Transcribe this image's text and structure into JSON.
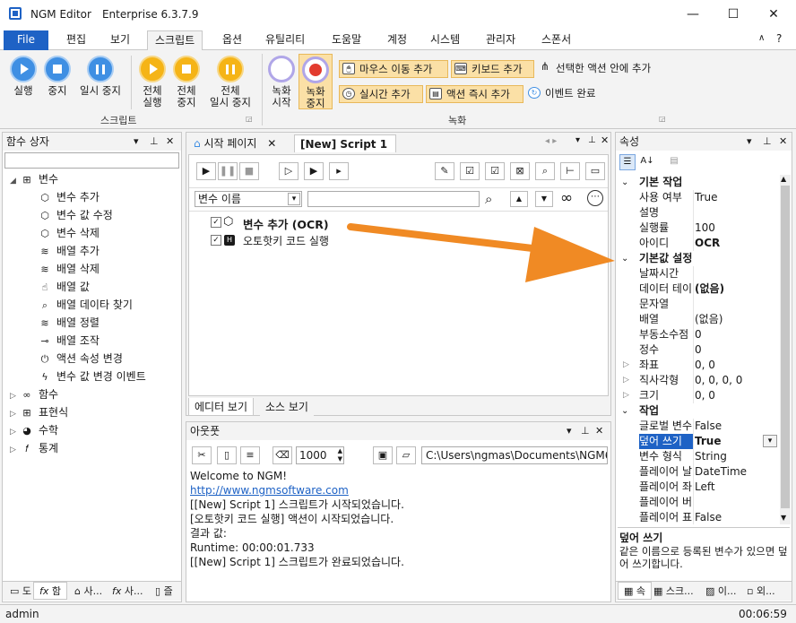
{
  "window": {
    "app_name": "NGM Editor",
    "edition": "Enterprise 6.3.7.9",
    "controls": {
      "minimize": "—",
      "maximize": "☐",
      "close": "✕"
    }
  },
  "menu": {
    "file": "File",
    "tabs": [
      "편집",
      "보기",
      "스크립트",
      "옵션",
      "유틸리티",
      "도움말",
      "계정",
      "시스템",
      "관리자",
      "스폰서"
    ],
    "active_tab": "스크립트"
  },
  "ribbon": {
    "script_group": {
      "label": "스크립트",
      "buttons": {
        "run": "실행",
        "stop": "중지",
        "pause": "일시 중지",
        "run_all": [
          "전체",
          "실행"
        ],
        "stop_all": [
          "전체",
          "중지"
        ],
        "pause_all": [
          "전체",
          "일시 중지"
        ]
      }
    },
    "record_group": {
      "label": "녹화",
      "record_start": [
        "녹화",
        "시작"
      ],
      "record_stop": [
        "녹화",
        "중지"
      ],
      "mouse_move_add": "마우스 이동 추가",
      "keyboard_add": "키보드 추가",
      "add_in_selected_action": "선택한 액션 안에 추가",
      "realtime_add": "실시간 추가",
      "instant_action_add": "액션 즉시 추가",
      "event_complete": "이벤트 완료"
    }
  },
  "left_panel": {
    "title": "함수 상자",
    "tree": [
      {
        "label": "변수",
        "icon": "hierarchy-icon",
        "expanded": true,
        "level": 0
      },
      {
        "label": "변수 추가",
        "icon": "cube-icon",
        "level": 1
      },
      {
        "label": "변수 값 수정",
        "icon": "cube-icon",
        "level": 1
      },
      {
        "label": "변수 삭제",
        "icon": "cube-icon",
        "level": 1
      },
      {
        "label": "배열 추가",
        "icon": "database-icon",
        "level": 1
      },
      {
        "label": "배열 삭제",
        "icon": "database-icon",
        "level": 1
      },
      {
        "label": "배열 값",
        "icon": "pointer-icon",
        "level": 1
      },
      {
        "label": "배열 데이타 찾기",
        "icon": "magnifier-icon",
        "level": 1
      },
      {
        "label": "배열 정렬",
        "icon": "database-icon",
        "level": 1
      },
      {
        "label": "배열 조작",
        "icon": "toggle-icon",
        "level": 1
      },
      {
        "label": "액션 속성 변경",
        "icon": "power-icon",
        "level": 1
      },
      {
        "label": "변수 값 변경 이벤트",
        "icon": "lightning-icon",
        "level": 1
      },
      {
        "label": "함수",
        "icon": "infinity-icon",
        "expanded": false,
        "level": 0
      },
      {
        "label": "표현식",
        "icon": "grid-icon",
        "expanded": false,
        "level": 0
      },
      {
        "label": "수학",
        "icon": "pie-icon",
        "expanded": false,
        "level": 0
      },
      {
        "label": "통계",
        "icon": "fx-icon",
        "expanded": false,
        "level": 0
      }
    ],
    "bottom_tabs": [
      "도",
      "함",
      "사...",
      "사...",
      "즐"
    ]
  },
  "editor": {
    "tabs": [
      {
        "label": "시작 페이지",
        "active": false
      },
      {
        "label": "[New] Script 1",
        "active": true
      }
    ],
    "variable_dropdown": "변수 이름",
    "search_value": "",
    "actions": [
      {
        "label": "변수 추가 (OCR)",
        "checked": true,
        "bold": true,
        "icon": "cube-icon"
      },
      {
        "label": "오토핫키 코드 실행",
        "checked": true,
        "bold": false,
        "icon": "autohotkey-icon"
      }
    ],
    "bottom_tabs": [
      "에디터 보기",
      "소스 보기"
    ]
  },
  "output": {
    "title": "아웃풋",
    "font_size": "1000",
    "path": "C:\\Users\\ngmas\\Documents\\NGM6\\",
    "lines": [
      {
        "text": "Welcome to NGM!",
        "link": false
      },
      {
        "text": "http://www.ngmsoftware.com",
        "link": true
      },
      {
        "text": "[[New] Script 1] 스크립트가 시작되었습니다.",
        "link": false
      },
      {
        "text": "[오토핫키 코드 실행] 액션이 시작되었습니다.",
        "link": false
      },
      {
        "text": "결과 값:",
        "link": false
      },
      {
        "text": "Runtime: 00:00:01.733",
        "link": false
      },
      {
        "text": "[[New] Script 1] 스크립트가 완료되었습니다.",
        "link": false
      }
    ]
  },
  "properties": {
    "title": "속성",
    "rows": [
      {
        "type": "cat",
        "name": "기본 작업"
      },
      {
        "type": "prop",
        "name": "사용 여부",
        "value": "True"
      },
      {
        "type": "prop",
        "name": "설명",
        "value": ""
      },
      {
        "type": "prop",
        "name": "실행률",
        "value": "100"
      },
      {
        "type": "prop",
        "name": "아이디",
        "value": "OCR",
        "bold": true
      },
      {
        "type": "cat",
        "name": "기본값 설정"
      },
      {
        "type": "prop",
        "name": "날짜시간",
        "value": ""
      },
      {
        "type": "prop",
        "name": "데이터 테이",
        "value": "(없음)",
        "bold": true
      },
      {
        "type": "prop",
        "name": "문자열",
        "value": ""
      },
      {
        "type": "prop",
        "name": "배열",
        "value": "(없음)"
      },
      {
        "type": "prop",
        "name": "부동소수점",
        "value": "0"
      },
      {
        "type": "prop",
        "name": "정수",
        "value": "0"
      },
      {
        "type": "prop",
        "name": "좌표",
        "value": "0, 0",
        "expandable": true
      },
      {
        "type": "prop",
        "name": "직사각형",
        "value": "0, 0, 0, 0",
        "expandable": true
      },
      {
        "type": "prop",
        "name": "크기",
        "value": "0, 0",
        "expandable": true
      },
      {
        "type": "cat",
        "name": "작업"
      },
      {
        "type": "prop",
        "name": "글로벌 변수",
        "value": "False"
      },
      {
        "type": "prop",
        "name": "덮어 쓰기",
        "value": "True",
        "bold": true,
        "selected": true
      },
      {
        "type": "prop",
        "name": "변수 형식",
        "value": "String"
      },
      {
        "type": "prop",
        "name": "플레이어 날",
        "value": "DateTime"
      },
      {
        "type": "prop",
        "name": "플레이어 좌",
        "value": "Left"
      },
      {
        "type": "prop",
        "name": "플레이어 버",
        "value": ""
      },
      {
        "type": "prop",
        "name": "플레이어 표",
        "value": "False"
      }
    ],
    "desc_title": "덮어 쓰기",
    "desc_text": "같은 이름으로 등록된 변수가 있으면 덮어 쓰기합니다.",
    "bottom_tabs": [
      "속",
      "스크...",
      "이...",
      "외..."
    ]
  },
  "status": {
    "user": "admin",
    "time": "00:06:59"
  },
  "colors": {
    "accent": "#1e62c5",
    "arrow": "#f08a24",
    "selection": "#1e62c5",
    "record_active": "#fbe0a6"
  }
}
